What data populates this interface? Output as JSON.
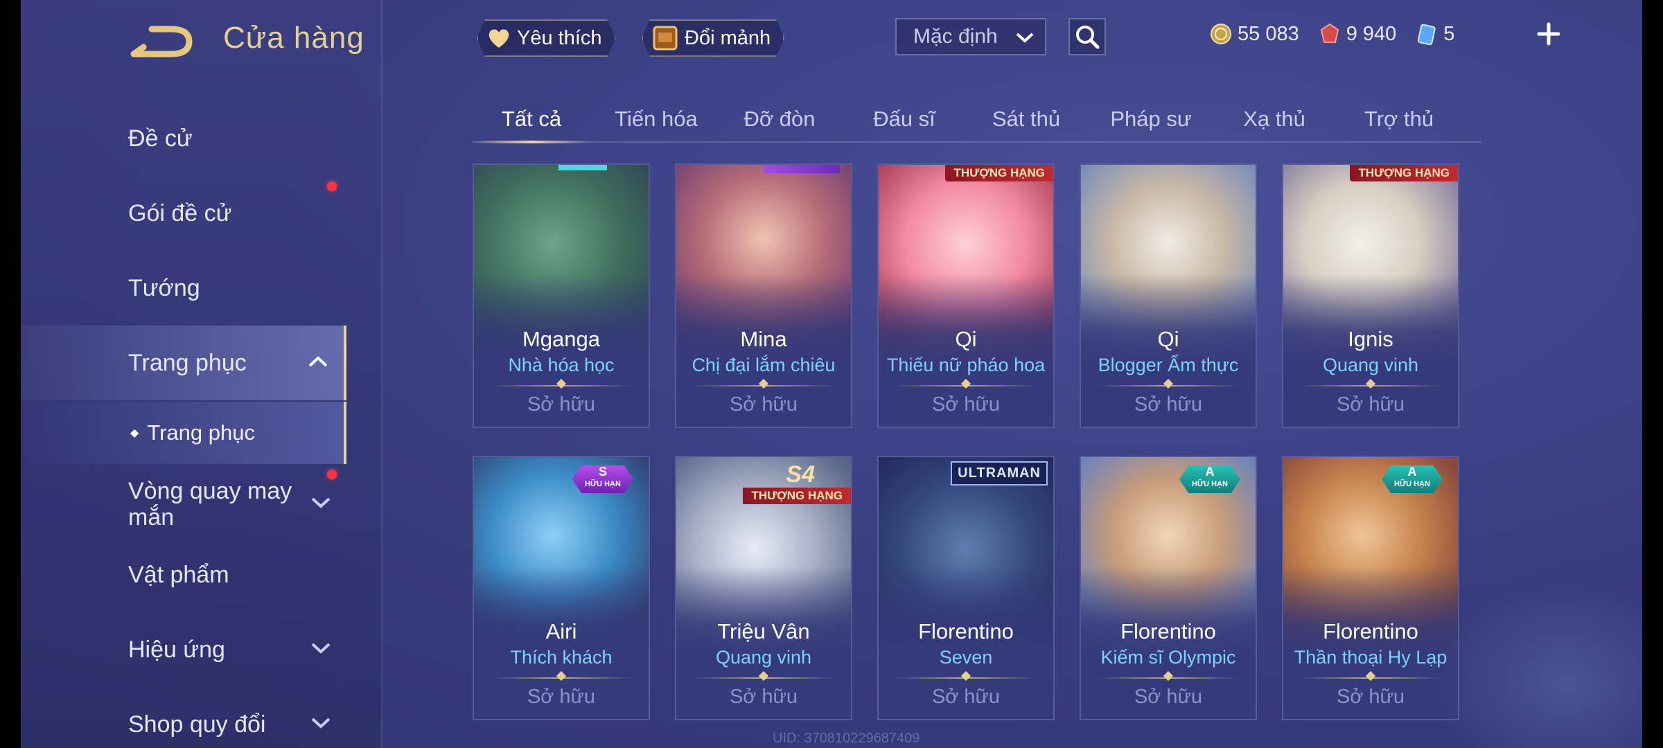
{
  "header": {
    "title": "Cửa hàng"
  },
  "sidebar": {
    "items": [
      {
        "label": "Đề cử"
      },
      {
        "label": "Gói đề cử"
      },
      {
        "label": "Tướng"
      },
      {
        "label": "Trang phục"
      },
      {
        "label": "Vòng quay may mắn"
      },
      {
        "label": "Vật phẩm"
      },
      {
        "label": "Hiệu ứng"
      },
      {
        "label": "Shop quy đổi"
      }
    ],
    "sub_item": "Trang phục"
  },
  "toolbar": {
    "favorite_label": "Yêu thích",
    "exchange_label": "Đổi mảnh",
    "sort_value": "Mặc định"
  },
  "currency": {
    "gold": "55 083",
    "vouchers": "9 940",
    "tickets": "5"
  },
  "tabs": [
    {
      "label": "Tất cả"
    },
    {
      "label": "Tiến hóa"
    },
    {
      "label": "Đỡ đòn"
    },
    {
      "label": "Đấu sĩ"
    },
    {
      "label": "Sát thủ"
    },
    {
      "label": "Pháp sư"
    },
    {
      "label": "Xạ thủ"
    },
    {
      "label": "Trợ thủ"
    }
  ],
  "cards": [
    {
      "hero": "Mganga",
      "skin": "Nhà hóa học",
      "status": "Sở hữu"
    },
    {
      "hero": "Mina",
      "skin": "Chị đại lắm chiêu",
      "status": "Sở hữu"
    },
    {
      "hero": "Qi",
      "skin": "Thiếu nữ pháo hoa",
      "status": "Sở hữu",
      "badge": "THƯỢNG HẠNG"
    },
    {
      "hero": "Qi",
      "skin": "Blogger Ẩm thực",
      "status": "Sở hữu"
    },
    {
      "hero": "Ignis",
      "skin": "Quang vinh",
      "status": "Sở hữu",
      "badge": "THƯỢNG HẠNG"
    },
    {
      "hero": "Airi",
      "skin": "Thích khách",
      "status": "Sở hữu",
      "badge": "S",
      "badge_sub": "HỮU HẠN"
    },
    {
      "hero": "Triệu Vân",
      "skin": "Quang vinh",
      "status": "Sở hữu",
      "badge": "S4",
      "badge_sub": "THƯỢNG HẠNG"
    },
    {
      "hero": "Florentino",
      "skin": "Seven",
      "status": "Sở hữu",
      "badge": "ULTRAMAN"
    },
    {
      "hero": "Florentino",
      "skin": "Kiếm sĩ Olympic",
      "status": "Sở hữu",
      "badge": "A",
      "badge_sub": "HỮU HẠN"
    },
    {
      "hero": "Florentino",
      "skin": "Thần thoại Hy Lạp",
      "status": "Sở hữu",
      "badge": "A",
      "badge_sub": "HỮU HẠN"
    }
  ],
  "uid": "UID: 370810229687409",
  "colors": {
    "accent_gold": "#e6cf93",
    "skin_name": "#7fd1ff",
    "owned": "#8d92c7",
    "notification": "#ff3344"
  }
}
